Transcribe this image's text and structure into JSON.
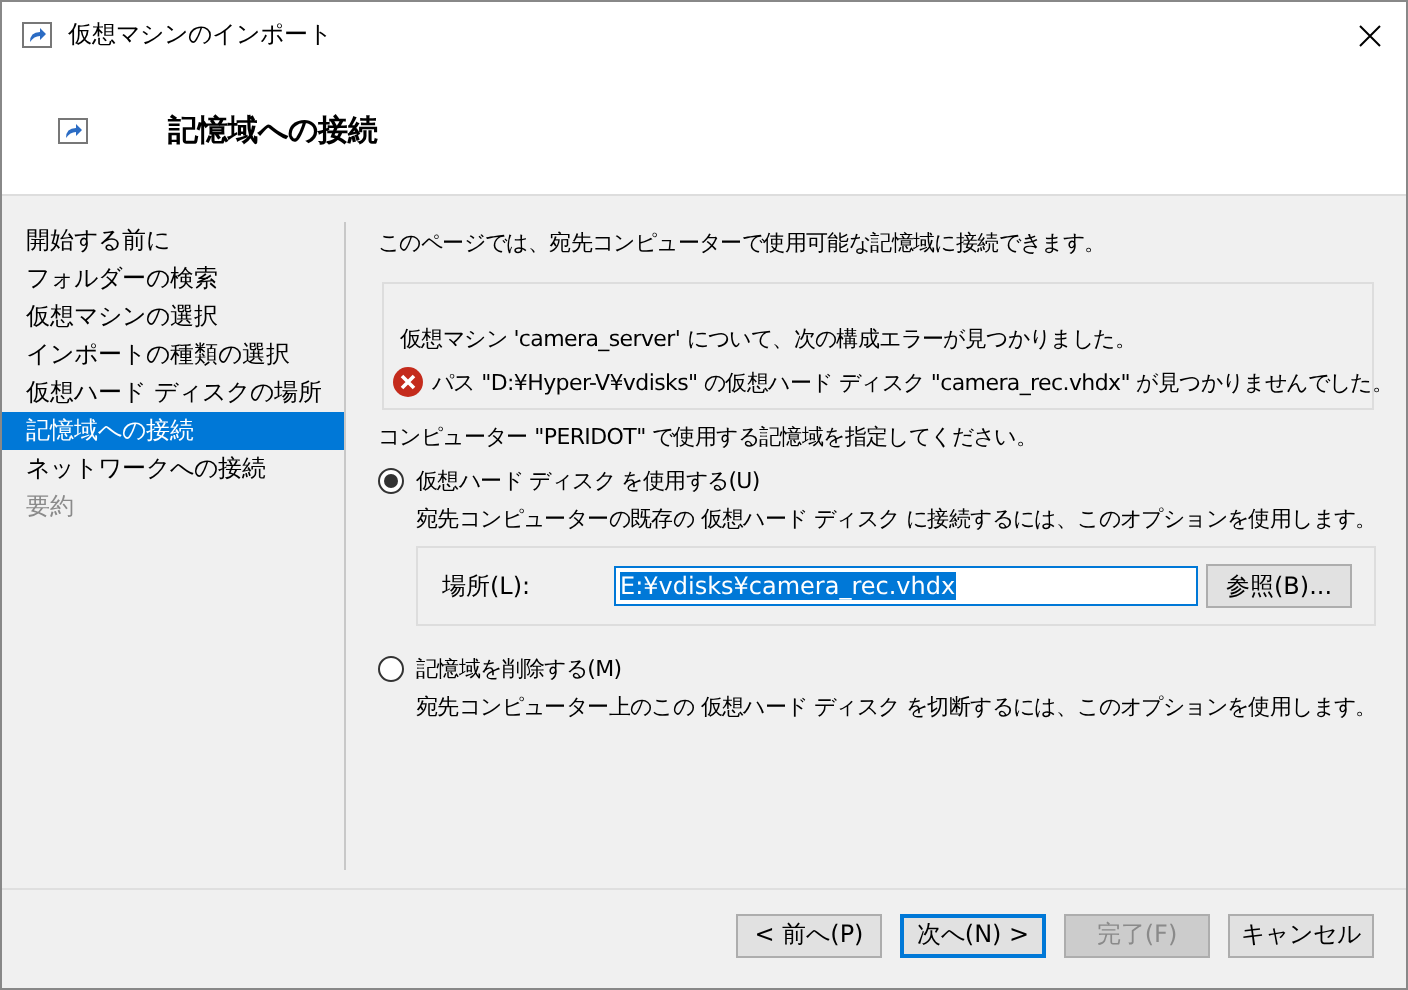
{
  "window": {
    "title": "仮想マシンのインポート"
  },
  "header": {
    "title": "記憶域への接続"
  },
  "sidebar": {
    "items": [
      {
        "label": "開始する前に",
        "selected": false,
        "disabled": false
      },
      {
        "label": "フォルダーの検索",
        "selected": false,
        "disabled": false
      },
      {
        "label": "仮想マシンの選択",
        "selected": false,
        "disabled": false
      },
      {
        "label": "インポートの種類の選択",
        "selected": false,
        "disabled": false
      },
      {
        "label": "仮想ハード ディスクの場所",
        "selected": false,
        "disabled": false
      },
      {
        "label": "記憶域への接続",
        "selected": true,
        "disabled": false
      },
      {
        "label": "ネットワークへの接続",
        "selected": false,
        "disabled": false
      },
      {
        "label": "要約",
        "selected": false,
        "disabled": true
      }
    ]
  },
  "intro": "このページでは、宛先コンピューターで使用可能な記憶域に接続できます。",
  "error_box": {
    "message": "仮想マシン 'camera_server' について、次の構成エラーが見つかりました。",
    "error": "パス \"D:¥Hyper-V¥vdisks\" の仮想ハード ディスク \"camera_rec.vhdx\" が見つかりませんでした。"
  },
  "prompt": "コンピューター \"PERIDOT\" で使用する記憶域を指定してください。",
  "options": [
    {
      "label": "仮想ハード ディスク を使用する(U)",
      "description": "宛先コンピューターの既存の 仮想ハード ディスク に接続するには、このオプションを使用します。",
      "selected": true,
      "location": {
        "label": "場所(L):",
        "value": "E:¥vdisks¥camera_rec.vhdx",
        "button": "参照(B)..."
      }
    },
    {
      "label": "記憶域を削除する(M)",
      "description": "宛先コンピューター上のこの 仮想ハード ディスク を切断するには、このオプションを使用します。",
      "selected": false
    }
  ],
  "buttons": [
    {
      "label": "< 前へ(P)",
      "default": false,
      "disabled": false
    },
    {
      "label": "次へ(N) >",
      "default": true,
      "disabled": false
    },
    {
      "label": "完了(F)",
      "default": false,
      "disabled": true
    },
    {
      "label": "キャンセル",
      "default": false,
      "disabled": false
    }
  ]
}
